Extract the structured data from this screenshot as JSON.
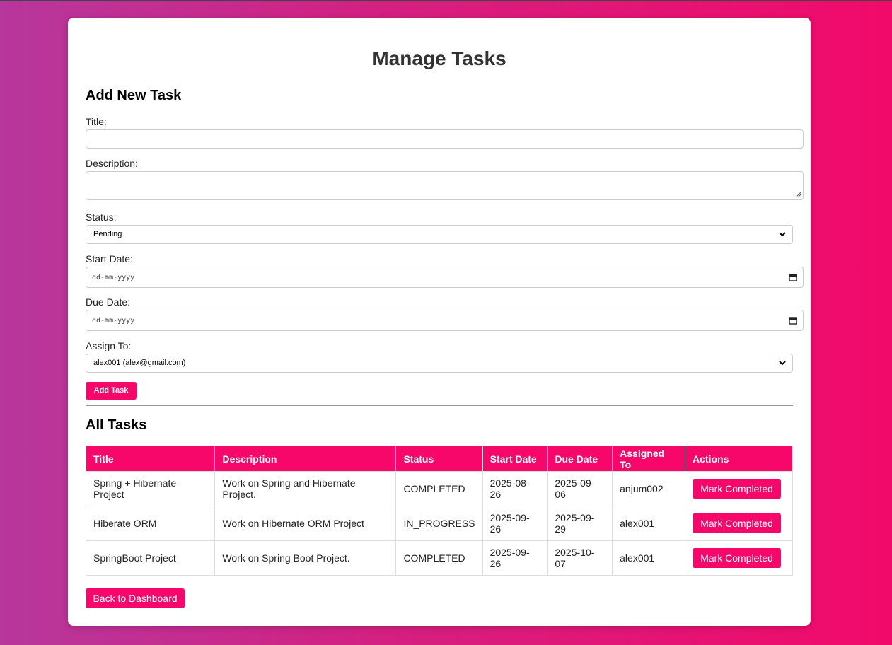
{
  "page": {
    "title": "Manage Tasks"
  },
  "form": {
    "heading": "Add New Task",
    "title_label": "Title:",
    "title_value": "",
    "description_label": "Description:",
    "description_value": "",
    "status_label": "Status:",
    "status_value": "Pending",
    "start_date_label": "Start Date:",
    "start_date_placeholder": "dd-mm-yyyy",
    "due_date_label": "Due Date:",
    "due_date_placeholder": "dd-mm-yyyy",
    "assign_label": "Assign To:",
    "assign_value": "alex001 (alex@gmail.com)",
    "submit_label": "Add Task"
  },
  "tasks": {
    "heading": "All Tasks",
    "columns": [
      "Title",
      "Description",
      "Status",
      "Start Date",
      "Due Date",
      "Assigned To",
      "Actions"
    ],
    "rows": [
      {
        "title": "Spring + Hibernate Project",
        "description": "Work on Spring and Hibernate Project.",
        "status": "COMPLETED",
        "start": "2025-08-26",
        "due": "2025-09-06",
        "assigned": "anjum002",
        "action": "Mark Completed"
      },
      {
        "title": "Hiberate ORM",
        "description": "Work on Hibernate ORM Project",
        "status": "IN_PROGRESS",
        "start": "2025-09-26",
        "due": "2025-09-29",
        "assigned": "alex001",
        "action": "Mark Completed"
      },
      {
        "title": "SpringBoot Project",
        "description": "Work on Spring Boot Project.",
        "status": "COMPLETED",
        "start": "2025-09-26",
        "due": "2025-10-07",
        "assigned": "alex001",
        "action": "Mark Completed"
      }
    ]
  },
  "nav": {
    "back_label": "Back to Dashboard"
  },
  "colors": {
    "accent": "#f60769",
    "heading": "#333333"
  }
}
